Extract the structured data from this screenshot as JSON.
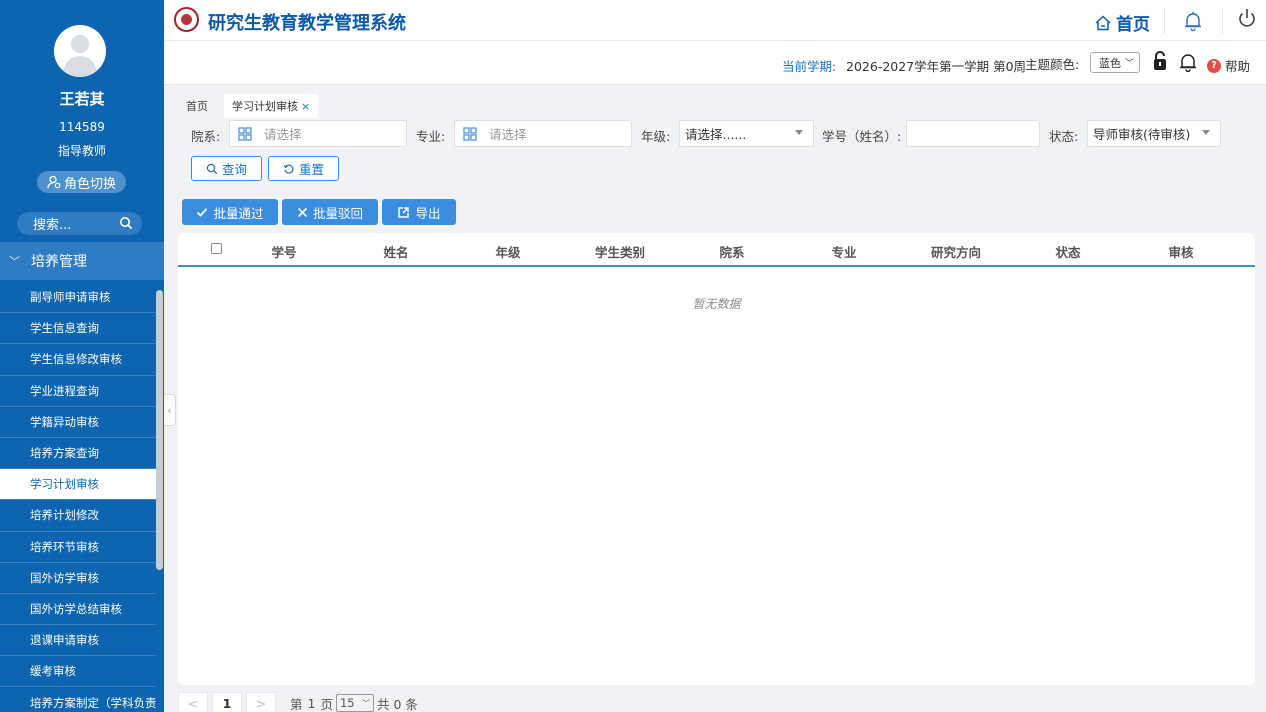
{
  "app": {
    "title": "研究生教育教学管理系统"
  },
  "user": {
    "name": "王若其",
    "id": "114589",
    "role": "指导教师",
    "switch_label": "角色切换"
  },
  "sidebar": {
    "search_placeholder": "搜索...",
    "group_label": "培养管理",
    "items": [
      {
        "label": "副导师申请审核"
      },
      {
        "label": "学生信息查询"
      },
      {
        "label": "学生信息修改审核"
      },
      {
        "label": "学业进程查询"
      },
      {
        "label": "学籍异动审核"
      },
      {
        "label": "培养方案查询"
      },
      {
        "label": "学习计划审核"
      },
      {
        "label": "培养计划修改"
      },
      {
        "label": "培养环节审核"
      },
      {
        "label": "国外访学审核"
      },
      {
        "label": "国外访学总结审核"
      },
      {
        "label": "退课申请审核"
      },
      {
        "label": "缓考审核"
      },
      {
        "label": "培养方案制定（学科负责"
      }
    ],
    "active_index": 6
  },
  "header": {
    "home_label": "首页"
  },
  "subbar": {
    "term_label": "当前学期:",
    "term_value": "2026-2027学年第一学期 第0周",
    "theme_label": "主题颜色:",
    "theme_value": "蓝色",
    "help_label": "帮助"
  },
  "tabs": [
    {
      "label": "首页"
    },
    {
      "label": "学习计划审核"
    }
  ],
  "tab_close": "×",
  "filters": {
    "dept_label": "院系:",
    "dept_placeholder": "请选择",
    "major_label": "专业:",
    "major_placeholder": "请选择",
    "grade_label": "年级:",
    "grade_value": "请选择......",
    "student_label": "学号（姓名）:",
    "student_value": "",
    "status_label": "状态:",
    "status_value": "导师审核(待审核)"
  },
  "buttons": {
    "query": "查询",
    "reset": "重置",
    "batch_approve": "批量通过",
    "batch_reject": "批量驳回",
    "export": "导出"
  },
  "table": {
    "columns": [
      "学号",
      "姓名",
      "年级",
      "学生类别",
      "院系",
      "专业",
      "研究方向",
      "状态",
      "审核"
    ],
    "rows": [],
    "empty_text": "暂无数据"
  },
  "pagination": {
    "prev": "<",
    "current_page": "1",
    "next": ">",
    "page_prefix": "第",
    "page_value": "1",
    "page_suffix": "页",
    "page_size": "15",
    "total_text": "共 0 条"
  },
  "colors": {
    "sidebar": "#0d64b0",
    "accent": "#3a8de0",
    "title": "#0d5aa7"
  }
}
